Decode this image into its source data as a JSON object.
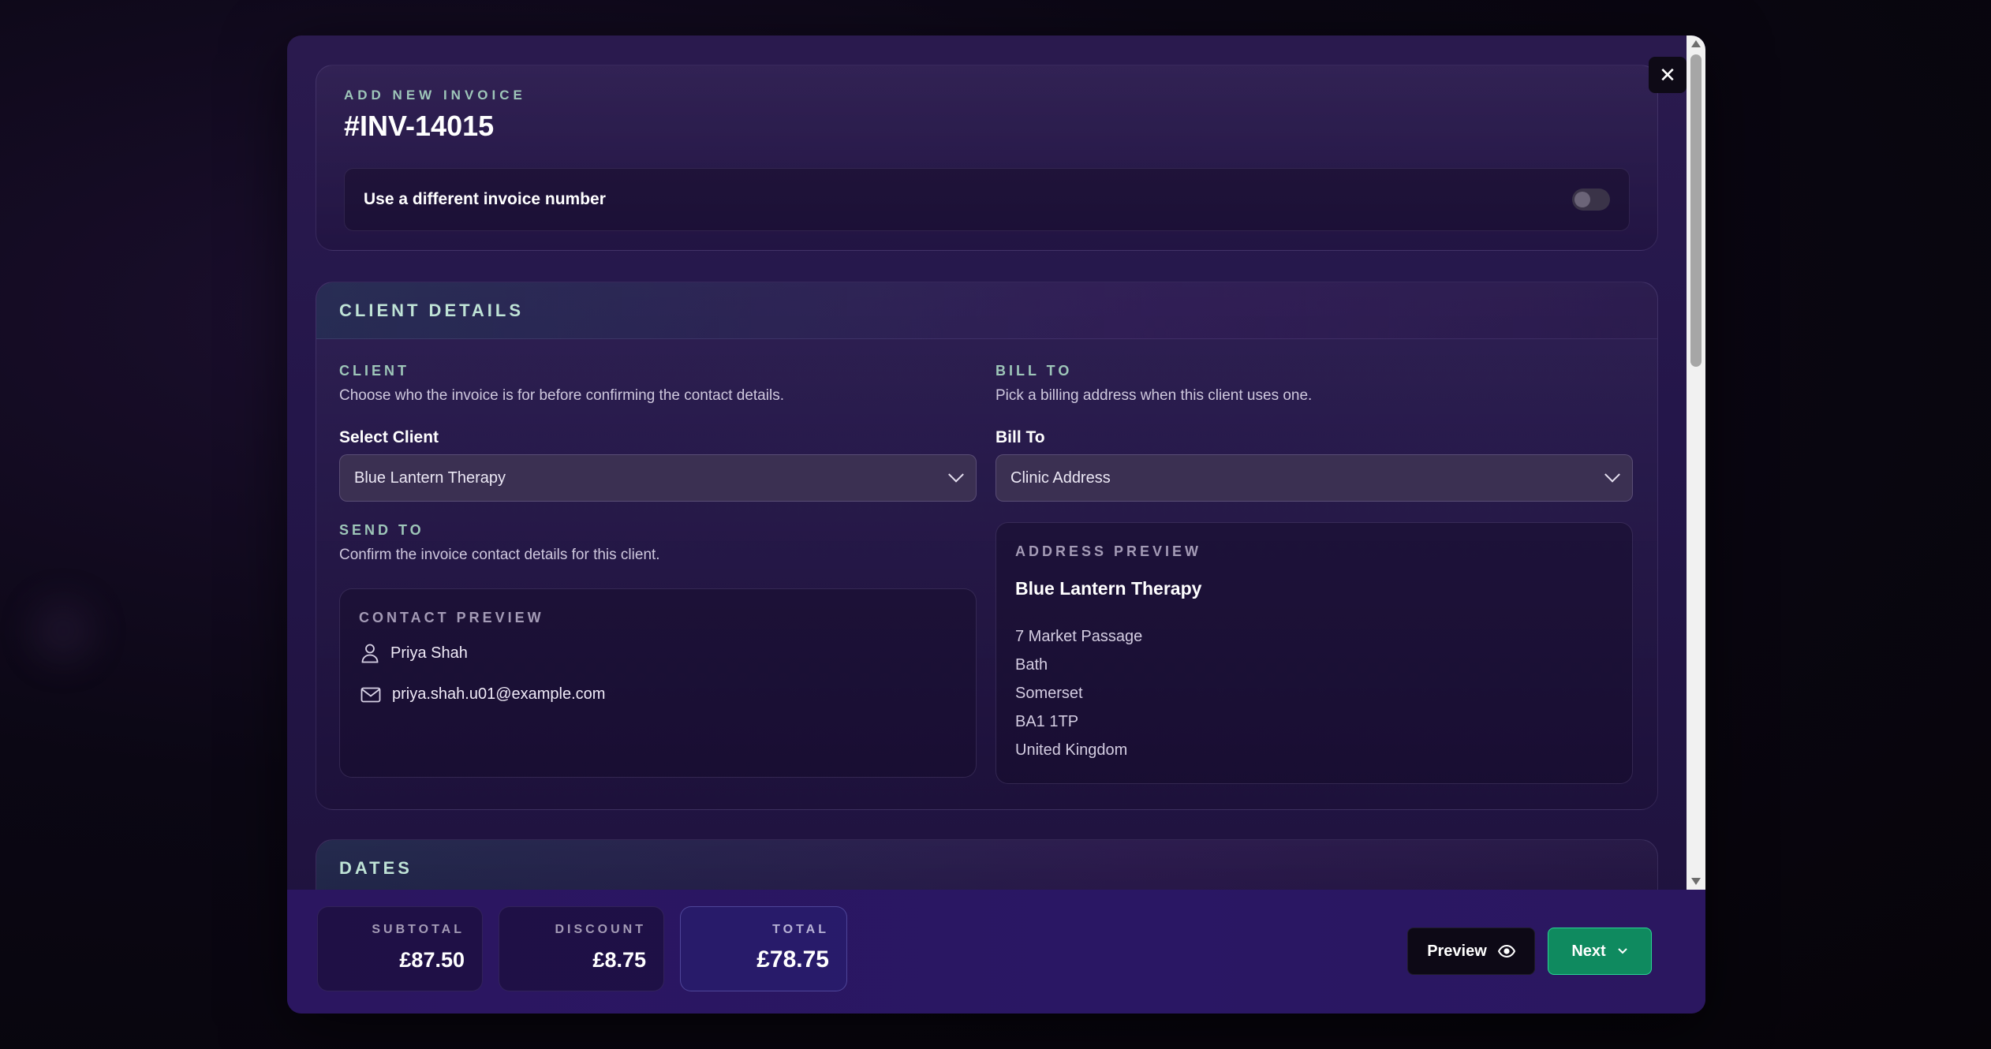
{
  "invoice": {
    "eyebrow": "ADD NEW INVOICE",
    "number": "#INV-14015",
    "toggle_label": "Use a different invoice number",
    "toggle_on": false
  },
  "client_details": {
    "title": "CLIENT DETAILS",
    "client": {
      "eyebrow": "CLIENT",
      "helper": "Choose who the invoice is for before confirming the contact details.",
      "select_label": "Select Client",
      "selected": "Blue Lantern Therapy"
    },
    "bill_to": {
      "eyebrow": "BILL TO",
      "helper": "Pick a billing address when this client uses one.",
      "select_label": "Bill To",
      "selected": "Clinic Address"
    },
    "send_to": {
      "eyebrow": "SEND TO",
      "helper": "Confirm the invoice contact details for this client."
    },
    "contact_preview": {
      "eyebrow": "CONTACT PREVIEW",
      "name": "Priya Shah",
      "email": "priya.shah.u01@example.com"
    },
    "address_preview": {
      "eyebrow": "ADDRESS PREVIEW",
      "name": "Blue Lantern Therapy",
      "lines": [
        "7 Market Passage",
        "Bath",
        "Somerset",
        "BA1 1TP",
        "United Kingdom"
      ]
    }
  },
  "dates": {
    "title": "DATES"
  },
  "footer": {
    "subtotal_label": "SUBTOTAL",
    "subtotal": "£87.50",
    "discount_label": "DISCOUNT",
    "discount": "£8.75",
    "total_label": "TOTAL",
    "total": "£78.75",
    "preview_label": "Preview",
    "next_label": "Next"
  },
  "icons": {
    "close": "close-icon",
    "person": "person-icon",
    "mail": "mail-icon",
    "eye": "eye-icon",
    "chevron": "chevron-down-icon"
  },
  "colors": {
    "accent_green": "#0f8a5f",
    "eyebrow_teal": "#9ec6b9",
    "modal_bg": "#24164a"
  }
}
